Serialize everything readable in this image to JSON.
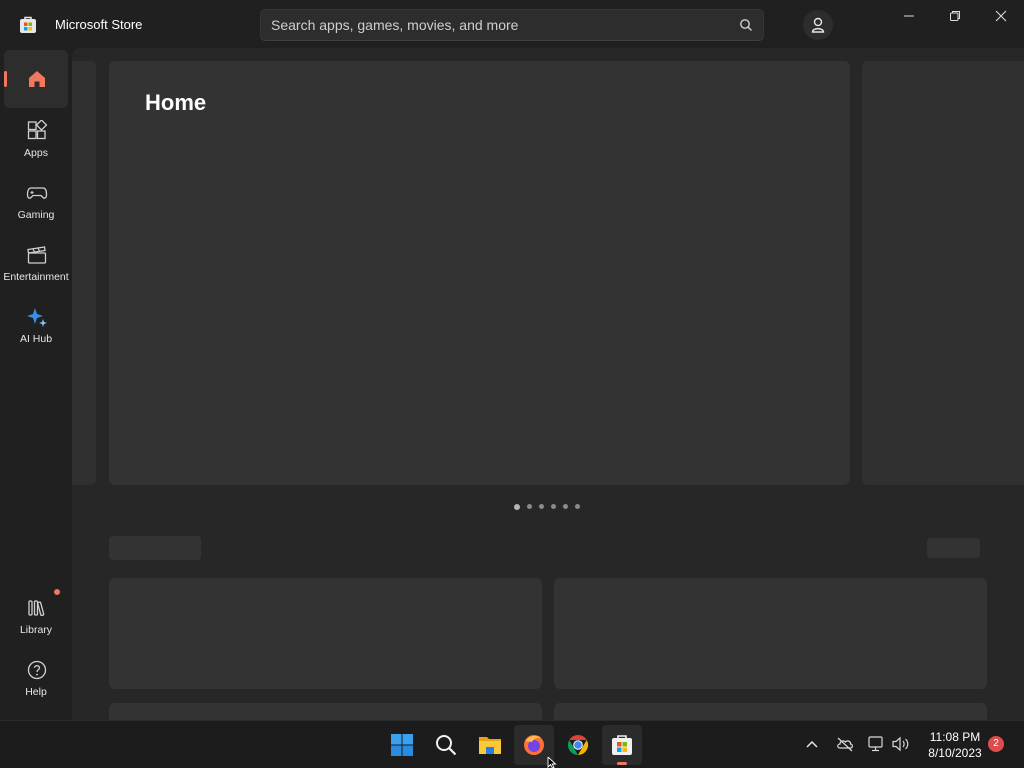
{
  "app": {
    "title": "Microsoft Store"
  },
  "search": {
    "placeholder": "Search apps, games, movies, and more"
  },
  "sidebar": {
    "items": [
      {
        "label": ""
      },
      {
        "label": "Apps"
      },
      {
        "label": "Gaming"
      },
      {
        "label": "Entertainment"
      },
      {
        "label": "AI Hub"
      }
    ],
    "bottom_items": [
      {
        "label": "Library"
      },
      {
        "label": "Help"
      }
    ]
  },
  "main": {
    "page_title": "Home",
    "carousel": {
      "slides": 6,
      "current": 1
    }
  },
  "taskbar": {
    "apps": [
      "start-icon",
      "search-icon",
      "file-explorer-icon",
      "firefox-icon",
      "chrome-icon",
      "microsoft-store-icon"
    ],
    "clock": {
      "time": "11:08 PM",
      "date": "8/10/2023"
    },
    "notification_count": "2"
  },
  "colors": {
    "accent": "#f1785e",
    "background": "#202020",
    "card": "#333333"
  }
}
